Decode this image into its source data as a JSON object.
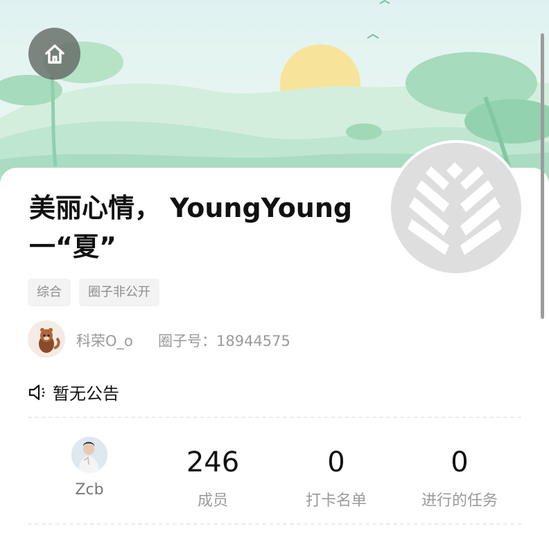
{
  "header": {
    "home_icon": "home-icon"
  },
  "circle": {
    "title": "美丽心情， YoungYoung一“夏”",
    "tags": [
      "综合",
      "圈子非公开"
    ],
    "logo_icon": "wheat-leaf-icon",
    "owner": {
      "name": "科荣O_o",
      "id_text": "圈子号：18944575"
    },
    "notice": {
      "icon": "speaker-icon",
      "text": "暂无公告"
    }
  },
  "stats": {
    "member": {
      "name": "Zcb"
    },
    "members": {
      "value": "246",
      "label": "成员"
    },
    "checkin": {
      "value": "0",
      "label": "打卡名单"
    },
    "tasks": {
      "value": "0",
      "label": "进行的任务"
    }
  },
  "colors": {
    "sky": "#dff2f1",
    "sun": "#f7e49a",
    "hills": "#a9dcc2",
    "logo_bg": "#dedede"
  }
}
